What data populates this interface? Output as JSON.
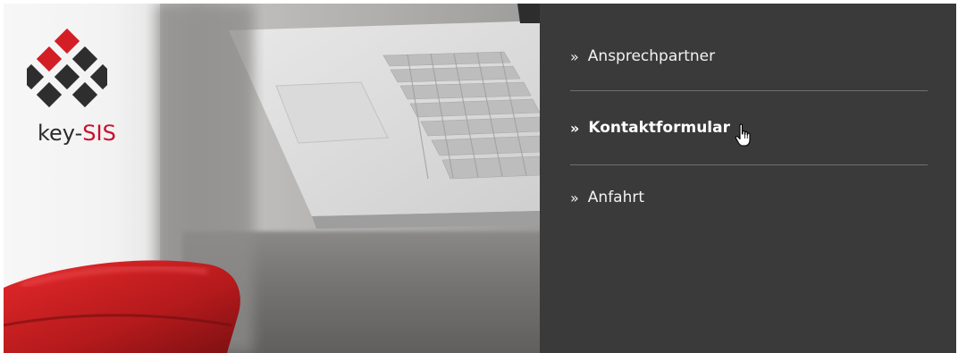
{
  "brand": {
    "name_prefix": "key-",
    "name_accent": "SIS",
    "colors": {
      "red": "#d31e25",
      "dark": "#2e2e2e",
      "panel": "#3a3a3a"
    }
  },
  "menu": {
    "items": [
      {
        "label": "Ansprechpartner",
        "marker": "»",
        "active": false
      },
      {
        "label": "Kontaktformular",
        "marker": "»",
        "active": true
      },
      {
        "label": "Anfahrt",
        "marker": "»",
        "active": false
      }
    ]
  },
  "icons": {
    "logo": "diamond-grid-logo-icon",
    "cursor": "hand-pointer-icon"
  }
}
